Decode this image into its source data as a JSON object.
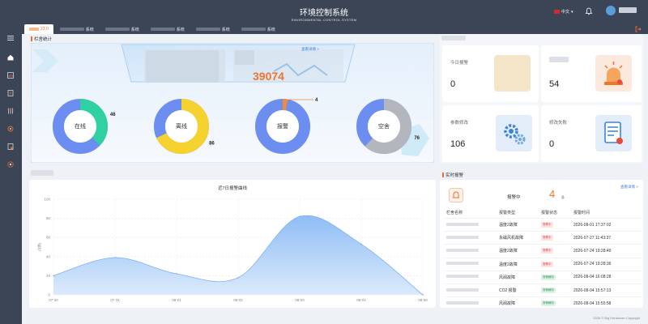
{
  "header": {
    "title": "环境控制系统",
    "subtitle": "ENVIRONMENTAL CONTROL SYSTEM",
    "language": "中文"
  },
  "tabs": [
    {
      "label": "23.0",
      "active": true
    },
    {
      "label": "系统",
      "active": false
    },
    {
      "label": "系统",
      "active": false
    },
    {
      "label": "系统",
      "active": false
    },
    {
      "label": "系统",
      "active": false
    },
    {
      "label": "系统",
      "active": false
    }
  ],
  "sidebar": {
    "icons": [
      "menu-icon",
      "home-icon",
      "report-icon",
      "clipboard-icon",
      "sliders-icon",
      "settings-icon",
      "alert-doc-icon",
      "gear-icon"
    ]
  },
  "barn_stats": {
    "title": "栏舍统计",
    "view_details": "查看详情 >",
    "total": "39074",
    "donuts": [
      {
        "label": "在线",
        "value": "46",
        "fraction": 0.37,
        "color": "#2fd0a1"
      },
      {
        "label": "离线",
        "value": "86",
        "fraction": 0.68,
        "color": "#f6d22e"
      },
      {
        "label": "报警",
        "value": "4",
        "fraction": 0.03,
        "color": "#f08a3c"
      },
      {
        "label": "空舍",
        "value": "76",
        "fraction": 0.62,
        "color": "#b3b6bc"
      }
    ]
  },
  "summary": [
    {
      "label": "今日报警",
      "value": "0",
      "icon": "image-placeholder-icon"
    },
    {
      "label": "",
      "value": "54",
      "icon": "alarm-light-icon"
    },
    {
      "label": "参数修改",
      "value": "106",
      "icon": "gears-icon"
    },
    {
      "label": "修改失败",
      "value": "0",
      "icon": "document-edit-icon"
    }
  ],
  "trend": {
    "title": "近7日报警曲线"
  },
  "chart_data": {
    "type": "area",
    "title": "近7日报警曲线",
    "ylabel": "(次数)",
    "x": [
      "07-30",
      "07-31",
      "08-01",
      "08-02",
      "08-03",
      "08-04",
      "08-05"
    ],
    "values": [
      20,
      39,
      22,
      18,
      82,
      53,
      0
    ],
    "ylim": [
      0,
      100
    ],
    "yticks": [
      "0",
      "20",
      "40",
      "60",
      "80",
      "100"
    ],
    "grid": true
  },
  "realtime": {
    "title": "实时报警",
    "view_details": "查看详情 >",
    "alarm_label": "报警中",
    "alarm_count": "4",
    "alarm_unit": "条",
    "columns": [
      "栏舍名称",
      "报警类型",
      "报警状态",
      "报警时间"
    ],
    "rows": [
      {
        "type": "温度2故障",
        "status": "报警中",
        "state": "alarm",
        "time": "2026-08-01 17:37:02"
      },
      {
        "type": "永磁风机故障",
        "status": "报警中",
        "state": "alarm",
        "time": "2026-07-27 11:43:37"
      },
      {
        "type": "温度2故障",
        "status": "报警中",
        "state": "alarm",
        "time": "2026-07-24 19:28:49"
      },
      {
        "type": "温度2故障",
        "status": "报警中",
        "state": "alarm",
        "time": "2026-07-24 19:28:36"
      },
      {
        "type": "风阀故障",
        "status": "报警解除",
        "state": "clear",
        "time": "2026-08-04 16:08:28"
      },
      {
        "type": "CO2 报警",
        "status": "报警解除",
        "state": "clear",
        "time": "2026-08-04 15:57:13"
      },
      {
        "type": "风阀故障",
        "status": "报警解除",
        "state": "clear",
        "time": "2026-08-04 15:55:58"
      }
    ]
  },
  "footer": {
    "copyright": "2026 © Big Herdsman Copyright"
  }
}
